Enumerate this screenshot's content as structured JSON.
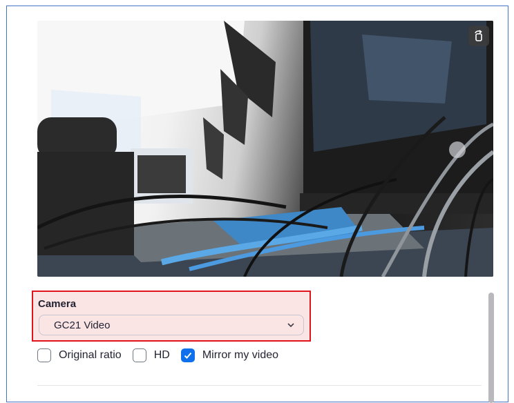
{
  "preview": {
    "rotate_icon": "rotate-camera-icon"
  },
  "camera": {
    "label": "Camera",
    "selected": "GC21 Video",
    "chevron_icon": "chevron-down-icon"
  },
  "options": [
    {
      "label": "Original ratio",
      "checked": false
    },
    {
      "label": "HD",
      "checked": false
    },
    {
      "label": "Mirror my video",
      "checked": true
    }
  ],
  "colors": {
    "highlight_border": "#e0131b",
    "highlight_fill": "#fbe4e4",
    "accent": "#0e71eb"
  }
}
